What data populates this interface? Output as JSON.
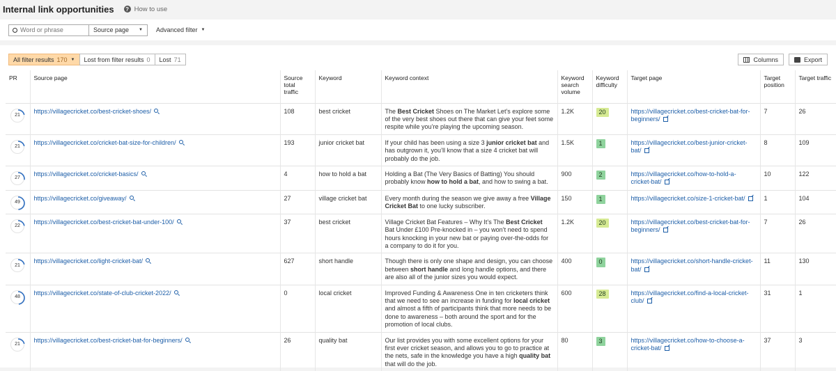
{
  "header": {
    "title": "Internal link opportunities",
    "how_to": "How to use"
  },
  "filters": {
    "search_placeholder": "Word or phrase",
    "scope": "Source page",
    "advanced": "Advanced filter"
  },
  "tabs": [
    {
      "label": "All filter results",
      "count": "170"
    },
    {
      "label": "Lost from filter results",
      "count": "0"
    },
    {
      "label": "Lost",
      "count": "71"
    }
  ],
  "actions": {
    "columns": "Columns",
    "export": "Export"
  },
  "columns": {
    "pr": "PR",
    "source_page": "Source page",
    "source_traffic": "Source total traffic",
    "keyword": "Keyword",
    "context": "Keyword context",
    "volume": "Keyword search volume",
    "difficulty": "Keyword difficulty",
    "target_page": "Target page",
    "target_position": "Target position",
    "target_traffic": "Target traffic"
  },
  "colors": {
    "kd_green": "#8fd39d",
    "kd_yellowgreen": "#d6ea93",
    "pr_arc": "#2f6fc1",
    "tab_active": "#ffd9a8"
  },
  "rows": [
    {
      "pr": "21",
      "source": "https://villagecricket.co/best-cricket-shoes/",
      "traffic": "108",
      "keyword": "best cricket",
      "context": [
        [
          "The ",
          false
        ],
        [
          "Best Cricket",
          true
        ],
        [
          " Shoes on The Market Let’s explore some of the very best shoes out there that can give your feet some respite while you’re playing the upcoming season.",
          false
        ]
      ],
      "volume": "1.2K",
      "kd": "20",
      "kd_color": "#d6ea93",
      "target": "https://villagecricket.co/best-cricket-bat-for-beginners/",
      "position": "7",
      "target_traffic": "26"
    },
    {
      "pr": "21",
      "source": "https://villagecricket.co/cricket-bat-size-for-children/",
      "traffic": "193",
      "keyword": "junior cricket bat",
      "context": [
        [
          "If your child has been using a size 3  ",
          false
        ],
        [
          "junior cricket bat",
          true
        ],
        [
          "  and has outgrown it, you’ll know that a size 4 cricket bat will probably do the job.",
          false
        ]
      ],
      "volume": "1.5K",
      "kd": "1",
      "kd_color": "#8fd39d",
      "target": "https://villagecricket.co/best-junior-cricket-bat/",
      "position": "8",
      "target_traffic": "109"
    },
    {
      "pr": "27",
      "source": "https://villagecricket.co/cricket-basics/",
      "traffic": "4",
      "keyword": "how to hold a bat",
      "context": [
        [
          "Holding a Bat (The Very Basics of Batting) You should probably know ",
          false
        ],
        [
          "how to hold a bat",
          true
        ],
        [
          ", and how to swing a bat.",
          false
        ]
      ],
      "volume": "900",
      "kd": "2",
      "kd_color": "#8fd39d",
      "target": "https://villagecricket.co/how-to-hold-a-cricket-bat/",
      "position": "10",
      "target_traffic": "122"
    },
    {
      "pr": "49",
      "source": "https://villagecricket.co/giveaway/",
      "traffic": "27",
      "keyword": "village cricket bat",
      "context": [
        [
          "Every month during the season we give away a free ",
          false
        ],
        [
          "Village Cricket Bat",
          true
        ],
        [
          " to one lucky subscriber.",
          false
        ]
      ],
      "volume": "150",
      "kd": "1",
      "kd_color": "#8fd39d",
      "target": "https://villagecricket.co/size-1-cricket-bat/",
      "position": "1",
      "target_traffic": "104"
    },
    {
      "pr": "22",
      "source": "https://villagecricket.co/best-cricket-bat-under-100/",
      "traffic": "37",
      "keyword": "best cricket",
      "context": [
        [
          "Village Cricket Bat Features – Why It’s The ",
          false
        ],
        [
          "Best Cricket",
          true
        ],
        [
          " Bat Under £100 Pre-knocked in  – you won’t need to spend hours knocking in your new bat or paying over-the-odds for a company to do it for you.",
          false
        ]
      ],
      "volume": "1.2K",
      "kd": "20",
      "kd_color": "#d6ea93",
      "target": "https://villagecricket.co/best-cricket-bat-for-beginners/",
      "position": "7",
      "target_traffic": "26"
    },
    {
      "pr": "21",
      "source": "https://villagecricket.co/light-cricket-bat/",
      "traffic": "627",
      "keyword": "short handle",
      "context": [
        [
          "Though there is only one shape and design, you can choose between ",
          false
        ],
        [
          "short handle",
          true
        ],
        [
          " and long handle options, and there are also all of the junior sizes you would expect.",
          false
        ]
      ],
      "volume": "400",
      "kd": "0",
      "kd_color": "#8fd39d",
      "target": "https://villagecricket.co/short-handle-cricket-bat/",
      "position": "11",
      "target_traffic": "130"
    },
    {
      "pr": "48",
      "source": "https://villagecricket.co/state-of-club-cricket-2022/",
      "traffic": "0",
      "keyword": "local cricket",
      "context": [
        [
          "Improved Funding & Awareness One in ten cricketers think that we need to see an increase in funding for ",
          false
        ],
        [
          "local cricket",
          true
        ],
        [
          " and almost a fifth of participants think that more needs to be done to awareness – both around the sport and for the promotion of local clubs.",
          false
        ]
      ],
      "volume": "600",
      "kd": "28",
      "kd_color": "#d6ea93",
      "target": "https://villagecricket.co/find-a-local-cricket-club/",
      "position": "31",
      "target_traffic": "1"
    },
    {
      "pr": "21",
      "source": "https://villagecricket.co/best-cricket-bat-for-beginners/",
      "traffic": "26",
      "keyword": "quality bat",
      "context": [
        [
          "Our list provides you with some excellent options for your first ever cricket season, and allows you to go to practice at the nets, safe in the knowledge you have a high ",
          false
        ],
        [
          "quality bat",
          true
        ],
        [
          " that will do the job.",
          false
        ]
      ],
      "volume": "80",
      "kd": "3",
      "kd_color": "#8fd39d",
      "target": "https://villagecricket.co/how-to-choose-a-cricket-bat/",
      "position": "37",
      "target_traffic": "3"
    }
  ]
}
